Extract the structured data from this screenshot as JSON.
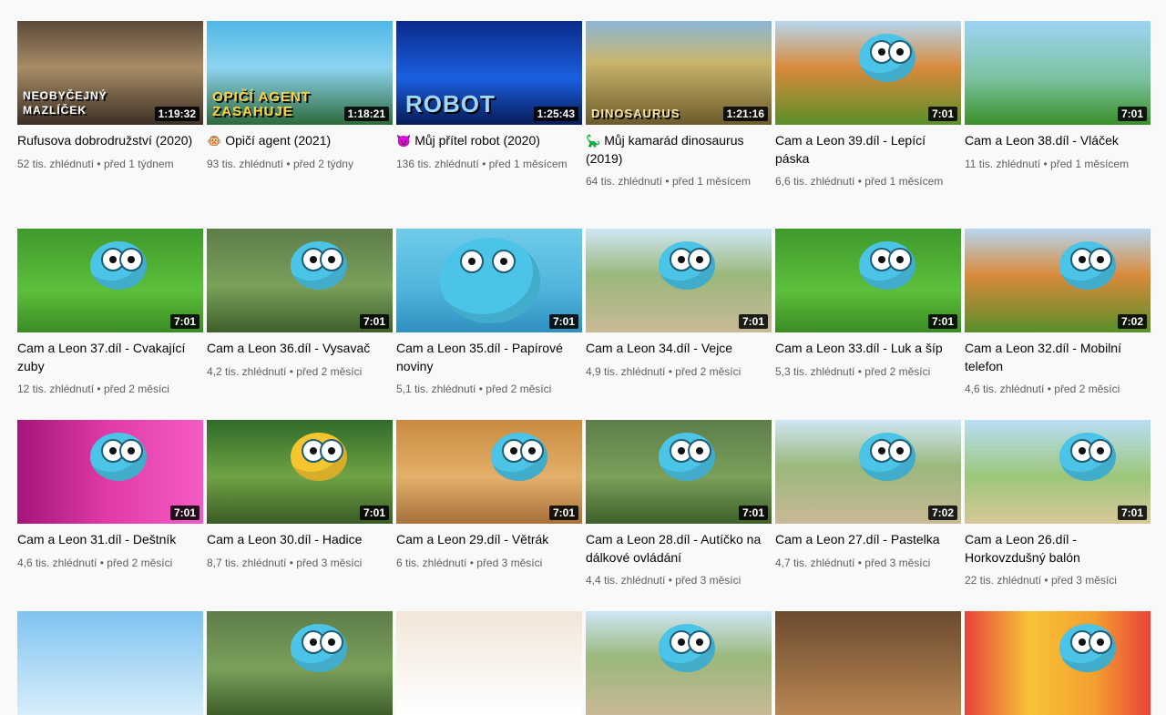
{
  "videos": [
    {
      "title": "Rufusova dobrodružství (2020)",
      "views": "52 tis. zhlédnutí",
      "age": "před 1 týdnem",
      "duration": "1:19:32",
      "prefix": "",
      "overlay": "NEOBYČEJNÝ MAZLÍČEK",
      "theme": "rufus"
    },
    {
      "title": "Opičí agent (2021)",
      "views": "93 tis. zhlédnutí",
      "age": "před 2 týdny",
      "duration": "1:18:21",
      "prefix": "🐵",
      "overlay": "OPIČÍ AGENT ZASAHUJE",
      "theme": "monkey"
    },
    {
      "title": "Můj přítel robot (2020)",
      "views": "136 tis. zhlédnutí",
      "age": "před 1 měsícem",
      "duration": "1:25:43",
      "prefix": "👿",
      "overlay": "ROBOT",
      "theme": "robot"
    },
    {
      "title": "Můj kamarád dinosaurus (2019)",
      "views": "64 tis. zhlédnutí",
      "age": "před 1 měsícem",
      "duration": "1:21:16",
      "prefix": "🦕",
      "overlay": "DINOSAURUS",
      "theme": "dino"
    },
    {
      "title": "Cam a Leon 39.díl - Lepící páska",
      "views": "6,6 tis. zhlédnutí",
      "age": "před 1 měsícem",
      "duration": "7:01",
      "prefix": "",
      "overlay": "",
      "theme": "cam-autumn"
    },
    {
      "title": "Cam a Leon 38.díl - Vláček",
      "views": "11 tis. zhlédnutí",
      "age": "před 1 měsícem",
      "duration": "7:01",
      "prefix": "",
      "overlay": "",
      "theme": "train"
    },
    {
      "title": "Cam a Leon 37.díl - Cvakající zuby",
      "views": "12 tis. zhlédnutí",
      "age": "před 2 měsíci",
      "duration": "7:01",
      "prefix": "",
      "overlay": "",
      "theme": "cam-grass"
    },
    {
      "title": "Cam a Leon 36.díl - Vysavač",
      "views": "4,2 tis. zhlédnutí",
      "age": "před 2 měsíci",
      "duration": "7:01",
      "prefix": "",
      "overlay": "",
      "theme": "cam-forest"
    },
    {
      "title": "Cam a Leon 35.díl - Papírové noviny",
      "views": "5,1 tis. zhlédnutí",
      "age": "před 2 měsíci",
      "duration": "7:01",
      "prefix": "",
      "overlay": "",
      "theme": "cam-blue"
    },
    {
      "title": "Cam a Leon 34.díl - Vejce",
      "views": "4,9 tis. zhlédnutí",
      "age": "před 2 měsíci",
      "duration": "7:01",
      "prefix": "",
      "overlay": "",
      "theme": "cam-park"
    },
    {
      "title": "Cam a Leon 33.díl - Luk a šíp",
      "views": "5,3 tis. zhlédnutí",
      "age": "před 2 měsíci",
      "duration": "7:01",
      "prefix": "",
      "overlay": "",
      "theme": "cam-grass"
    },
    {
      "title": "Cam a Leon 32.díl - Mobilní telefon",
      "views": "4,6 tis. zhlédnutí",
      "age": "před 2 měsíci",
      "duration": "7:02",
      "prefix": "",
      "overlay": "",
      "theme": "cam-autumn"
    },
    {
      "title": "Cam a Leon 31.díl - Deštník",
      "views": "4,6 tis. zhlédnutí",
      "age": "před 2 měsíci",
      "duration": "7:01",
      "prefix": "",
      "overlay": "",
      "theme": "cam-pink"
    },
    {
      "title": "Cam a Leon 30.díl - Hadice",
      "views": "8,7 tis. zhlédnutí",
      "age": "před 3 měsíci",
      "duration": "7:01",
      "prefix": "",
      "overlay": "",
      "theme": "cam-yellow"
    },
    {
      "title": "Cam a Leon 29.díl - Větrák",
      "views": "6 tis. zhlédnutí",
      "age": "před 3 měsíci",
      "duration": "7:01",
      "prefix": "",
      "overlay": "",
      "theme": "cam-room"
    },
    {
      "title": "Cam a Leon 28.díl - Autíčko na dálkové ovládání",
      "views": "4,4 tis. zhlédnutí",
      "age": "před 3 měsíci",
      "duration": "7:01",
      "prefix": "",
      "overlay": "",
      "theme": "cam-forest"
    },
    {
      "title": "Cam a Leon 27.díl - Pastelka",
      "views": "4,7 tis. zhlédnutí",
      "age": "před 3 měsíci",
      "duration": "7:02",
      "prefix": "",
      "overlay": "",
      "theme": "cam-park"
    },
    {
      "title": "Cam a Leon 26.díl - Horkovzdušný balón",
      "views": "22 tis. zhlédnutí",
      "age": "před 3 měsíci",
      "duration": "7:01",
      "prefix": "",
      "overlay": "",
      "theme": "cam-playground"
    }
  ],
  "partial_row": [
    {
      "theme": "rabbit-sky"
    },
    {
      "theme": "cam-forest"
    },
    {
      "theme": "rabbit-light"
    },
    {
      "theme": "cam-park"
    },
    {
      "theme": "rabbit-brown"
    },
    {
      "theme": "cam-rainbow"
    }
  ]
}
